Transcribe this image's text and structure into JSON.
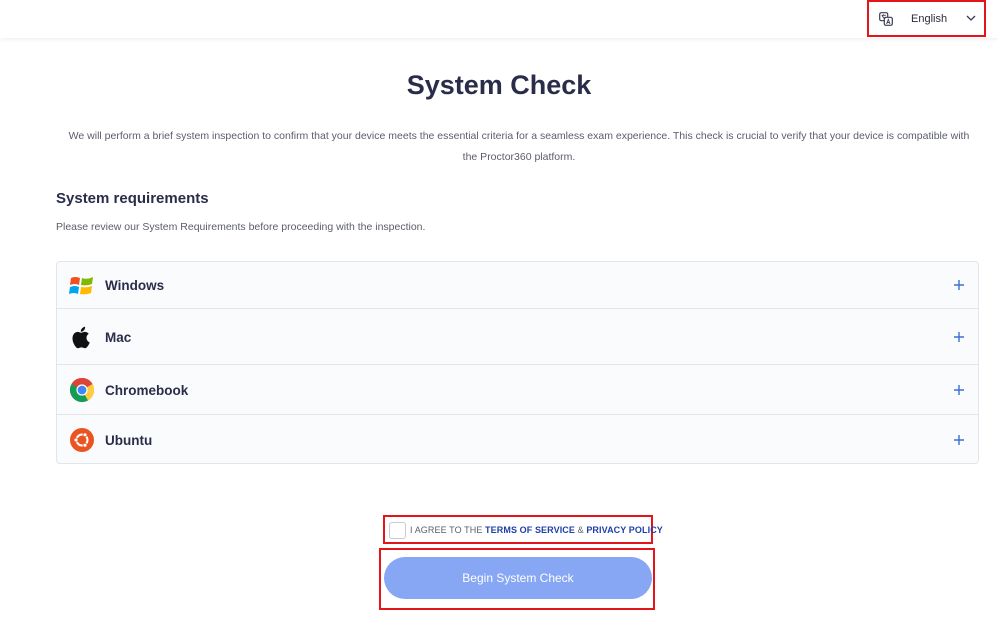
{
  "header": {
    "language": {
      "icon": "translate-icon",
      "label": "English",
      "chevron": "chevron-down-icon"
    }
  },
  "main": {
    "title": "System Check",
    "intro": "We will perform a brief system inspection to confirm that your device meets the essential criteria for a seamless exam experience. This check is crucial to verify that your device is compatible with the Proctor360 platform.",
    "requirements": {
      "heading": "System requirements",
      "subtext": "Please review our System Requirements before proceeding with the inspection.",
      "items": [
        {
          "label": "Windows",
          "icon": "windows-icon"
        },
        {
          "label": "Mac",
          "icon": "apple-icon"
        },
        {
          "label": "Chromebook",
          "icon": "chrome-icon"
        },
        {
          "label": "Ubuntu",
          "icon": "ubuntu-icon"
        }
      ],
      "expand_icon": "plus-icon"
    }
  },
  "footer": {
    "agree_prefix": "I AGREE TO THE",
    "terms_link": "TERMS OF SERVICE",
    "ampersand": "&",
    "privacy_link": "PRIVACY POLICY",
    "checked": false,
    "begin_button": "Begin System Check"
  },
  "colors": {
    "accent": "#1e3fa8",
    "button": "#87a6f4",
    "highlight": "#e3151a",
    "plus": "#3a6fd8"
  }
}
